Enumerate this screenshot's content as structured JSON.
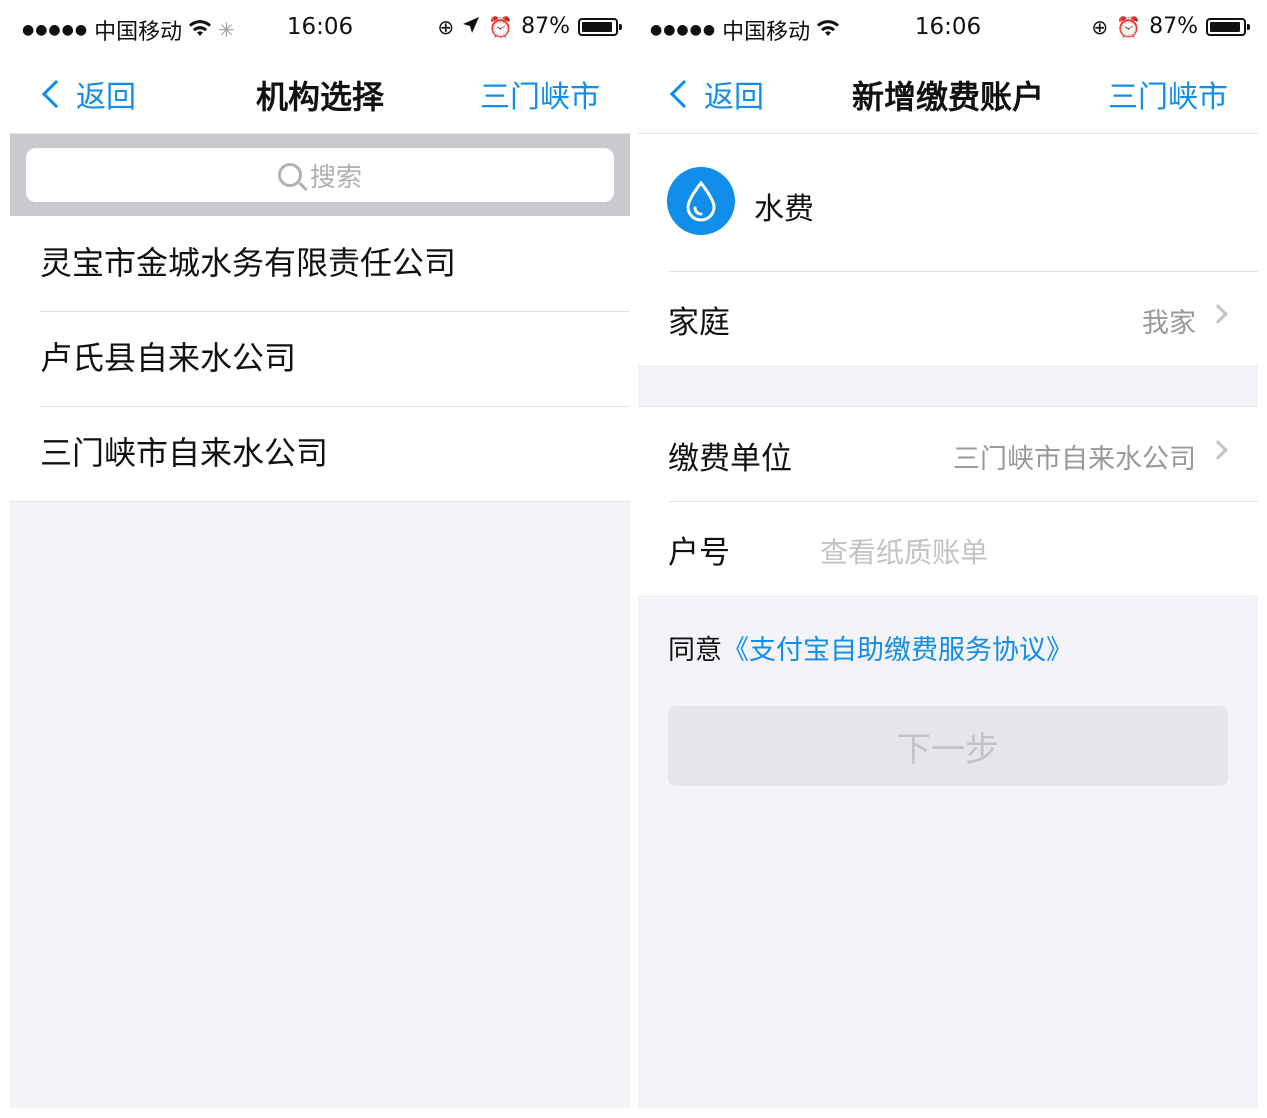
{
  "left": {
    "status": {
      "carrier": "中国移动",
      "time": "16:06",
      "battery": "87%"
    },
    "nav": {
      "back": "返回",
      "title": "机构选择",
      "city": "三门峡市"
    },
    "search": {
      "placeholder": "搜索"
    },
    "institutions": [
      "灵宝市金城水务有限责任公司",
      "卢氏县自来水公司",
      "三门峡市自来水公司"
    ]
  },
  "right": {
    "status": {
      "carrier": "中国移动",
      "time": "16:06",
      "battery": "87%"
    },
    "nav": {
      "back": "返回",
      "title": "新增缴费账户",
      "city": "三门峡市"
    },
    "service": {
      "name": "水费",
      "icon": "water-drop-icon"
    },
    "family": {
      "label": "家庭",
      "value": "我家"
    },
    "unit": {
      "label": "缴费单位",
      "value": "三门峡市自来水公司"
    },
    "account": {
      "label": "户号",
      "placeholder": "查看纸质账单"
    },
    "agreement": {
      "prefix": "同意",
      "link": "《支付宝自助缴费服务协议》"
    },
    "next_button": "下一步"
  },
  "colors": {
    "accent": "#108ee9",
    "background": "#f4f4f8",
    "disabled": "#e6e6ea"
  }
}
